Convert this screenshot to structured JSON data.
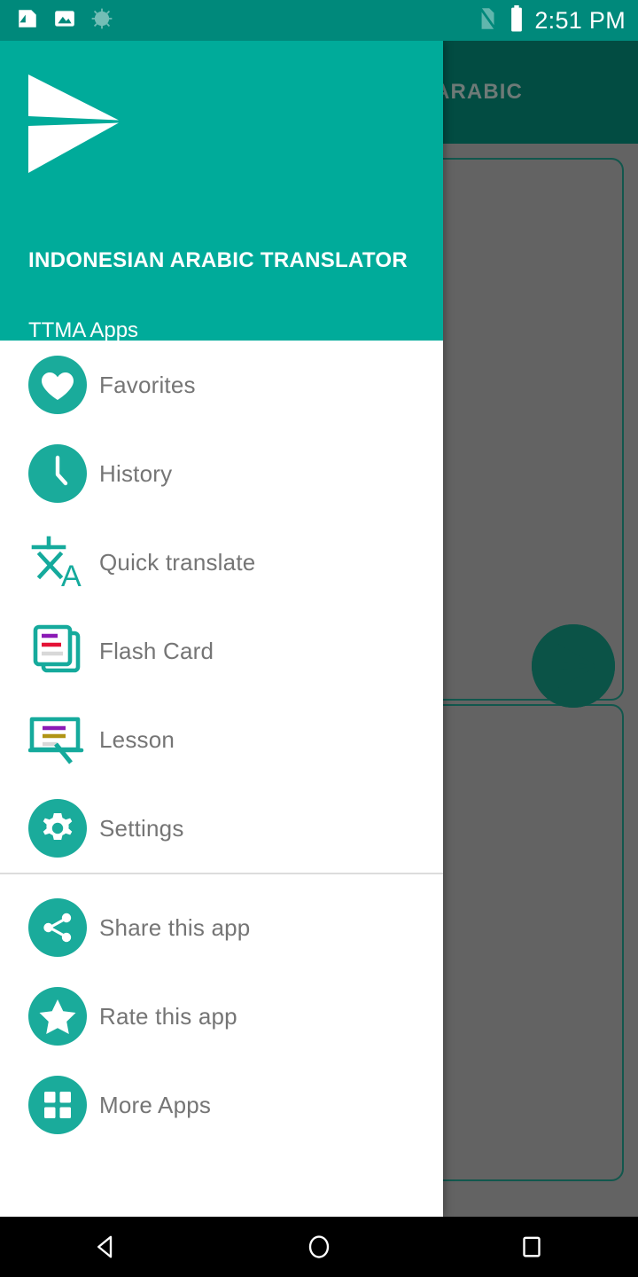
{
  "status_bar": {
    "time": "2:51 PM",
    "left_icons": [
      "screenshot-icon",
      "image-icon",
      "sync-spinner-icon"
    ],
    "right_icons": [
      "no-sim-icon",
      "battery-full-icon"
    ],
    "background_color": "#00897b"
  },
  "background_app": {
    "appbar_color": "#024c42",
    "scrim_color": "#636363",
    "tabs": [
      {
        "label": ""
      },
      {
        "label": "ARABIC"
      }
    ],
    "fab": {
      "icon": "send-icon",
      "color": "#0b5347"
    },
    "cards": [
      {
        "name": "source-text-card"
      },
      {
        "name": "target-text-card"
      }
    ]
  },
  "drawer": {
    "accent_color": "#00ab9a",
    "header": {
      "logo": "send-plane-logo",
      "title": "INDONESIAN ARABIC TRANSLATOR",
      "subtitle": "TTMA Apps"
    },
    "primary_items": [
      {
        "label": "Favorites",
        "icon": "heart-icon"
      },
      {
        "label": "History",
        "icon": "clock-icon"
      },
      {
        "label": "Quick translate",
        "icon": "translate-icon"
      },
      {
        "label": "Flash Card",
        "icon": "flash-card-icon"
      },
      {
        "label": "Lesson",
        "icon": "lesson-board-icon"
      },
      {
        "label": "Settings",
        "icon": "gear-icon"
      }
    ],
    "secondary_items": [
      {
        "label": "Share this app",
        "icon": "share-icon"
      },
      {
        "label": "Rate this app",
        "icon": "star-icon"
      },
      {
        "label": "More Apps",
        "icon": "grid-apps-icon"
      }
    ]
  },
  "navigation_bar": {
    "buttons": [
      {
        "name": "back-button",
        "icon": "triangle-back-icon"
      },
      {
        "name": "home-button",
        "icon": "circle-home-icon"
      },
      {
        "name": "recents-button",
        "icon": "square-recents-icon"
      }
    ]
  }
}
